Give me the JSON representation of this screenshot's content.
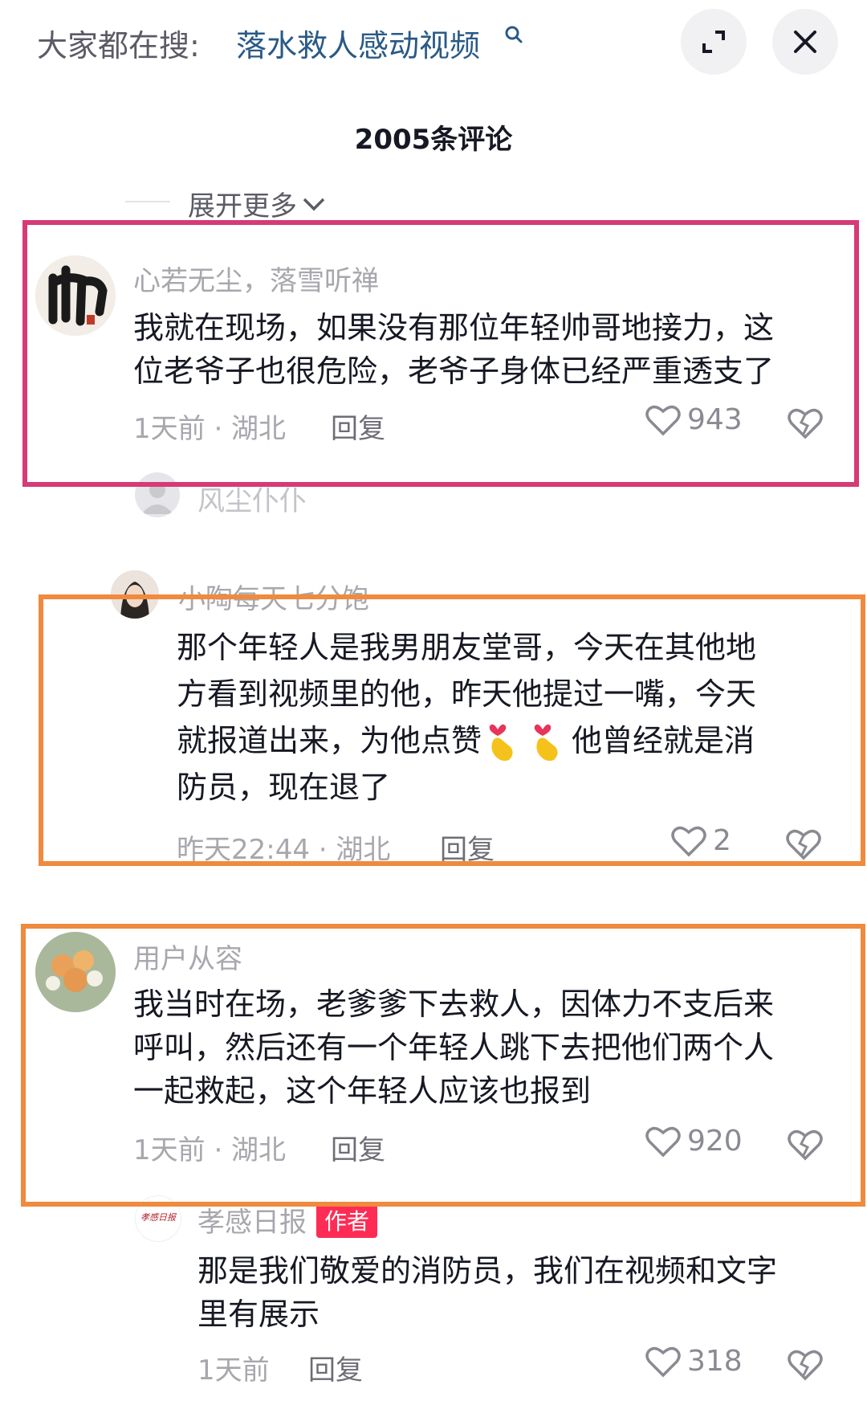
{
  "search": {
    "prefix": "大家都在搜:",
    "term": "落水救人感动视频"
  },
  "header": {
    "comment_count": "2005条评论",
    "expand_more": "展开更多"
  },
  "comments": [
    {
      "username": "心若无尘，落雪听禅",
      "line1": "我就在现场，如果没有那位年轻帅哥地接力，这",
      "line2": "位老爷子也很危险，老爷子身体已经严重透支了",
      "time": "1天前 · 湖北",
      "reply": "回复",
      "likes": "943"
    },
    {
      "username": "风尘仆仆"
    },
    {
      "username": "小陶每天七分饱",
      "line1": "那个年轻人是我男朋友堂哥，今天在其他地",
      "line2": "方看到视频里的他，昨天他提过一嘴，今天",
      "line3a": "就报道出来，为他点赞",
      "line3b": "他曾经就是消",
      "line4": "防员，现在退了",
      "time": "昨天22:44 · 湖北",
      "reply": "回复",
      "likes": "2"
    },
    {
      "username": "用户从容",
      "line1": "我当时在场，老爹爹下去救人，因体力不支后来",
      "line2": "呼叫，然后还有一个年轻人跳下去把他们两个人",
      "line3": "一起救起，这个年轻人应该也报到",
      "time": "1天前 · 湖北",
      "reply": "回复",
      "likes": "920"
    },
    {
      "username": "孝感日报",
      "badge": "作者",
      "line1": "那是我们敬爱的消防员，我们在视频和文字",
      "line2": "里有展示",
      "time": "1天前",
      "reply": "回复",
      "likes": "318"
    }
  ],
  "avatar_logo_text": "孝感日报",
  "colors": {
    "search_term": "#2a5a87",
    "highlight_pink": "#d63a77",
    "highlight_orange": "#ef8a3e",
    "author_badge": "#fe2c55"
  }
}
